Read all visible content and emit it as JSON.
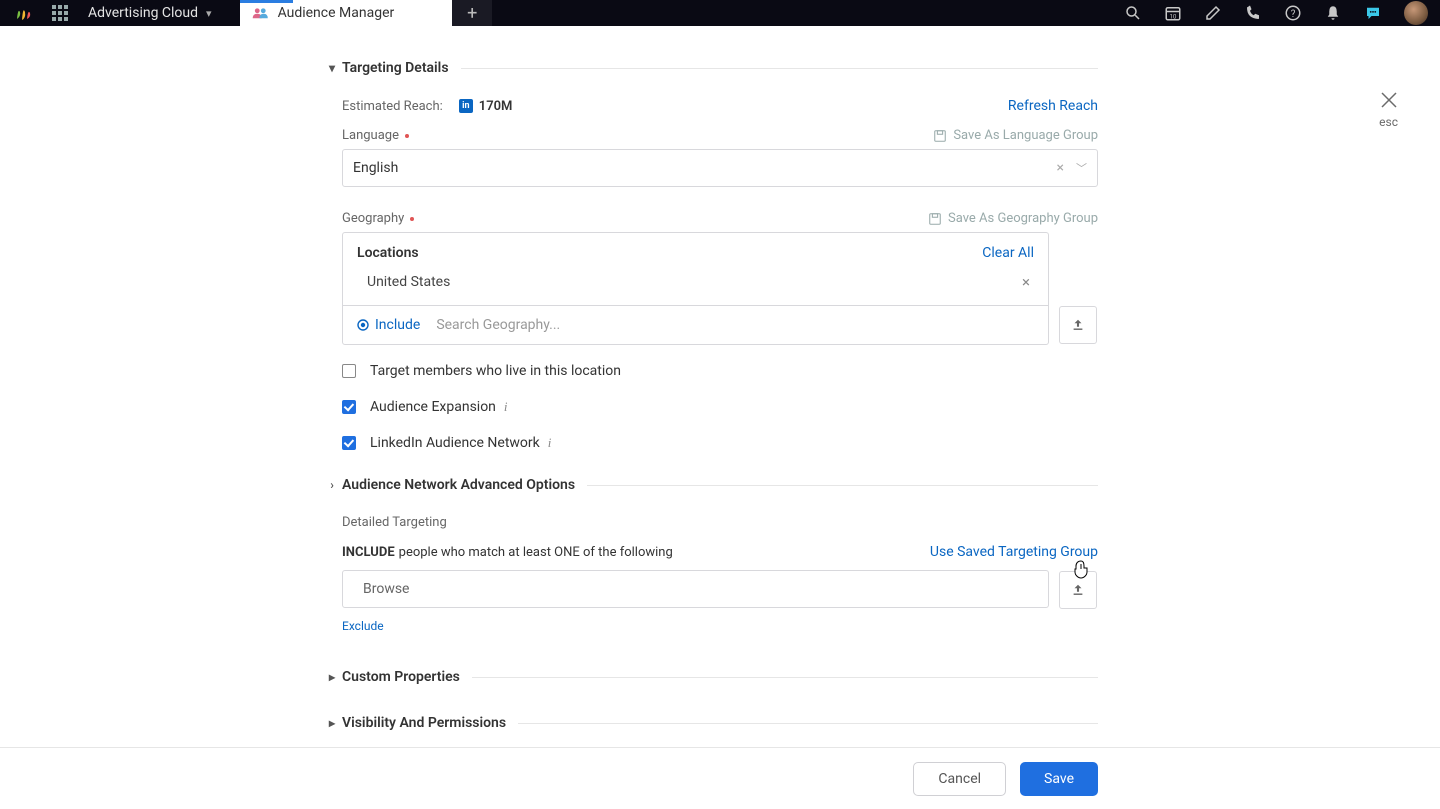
{
  "topbar": {
    "product": "Advertising Cloud",
    "tab_label": "Audience Manager"
  },
  "close": {
    "esc": "esc"
  },
  "sections": {
    "targeting_details": "Targeting Details",
    "advanced_options": "Audience Network Advanced Options",
    "custom_properties": "Custom Properties",
    "visibility": "Visibility And Permissions"
  },
  "reach": {
    "label": "Estimated Reach:",
    "value": "170M",
    "refresh": "Refresh Reach"
  },
  "language": {
    "label": "Language",
    "value": "English",
    "save_group": "Save As Language Group"
  },
  "geography": {
    "label": "Geography",
    "save_group": "Save As Geography Group",
    "locations_title": "Locations",
    "clear_all": "Clear All",
    "items": [
      "United States"
    ],
    "include_label": "Include",
    "search_placeholder": "Search Geography..."
  },
  "checkboxes": {
    "target_members": "Target members who live in this location",
    "audience_expansion": "Audience Expansion",
    "linkedin_network": "LinkedIn Audience Network"
  },
  "detailed": {
    "label": "Detailed Targeting",
    "include_word": "INCLUDE",
    "include_rest": "people who match at least ONE of the following",
    "use_saved": "Use Saved Targeting Group",
    "browse": "Browse",
    "exclude": "Exclude"
  },
  "footer": {
    "cancel": "Cancel",
    "save": "Save"
  }
}
